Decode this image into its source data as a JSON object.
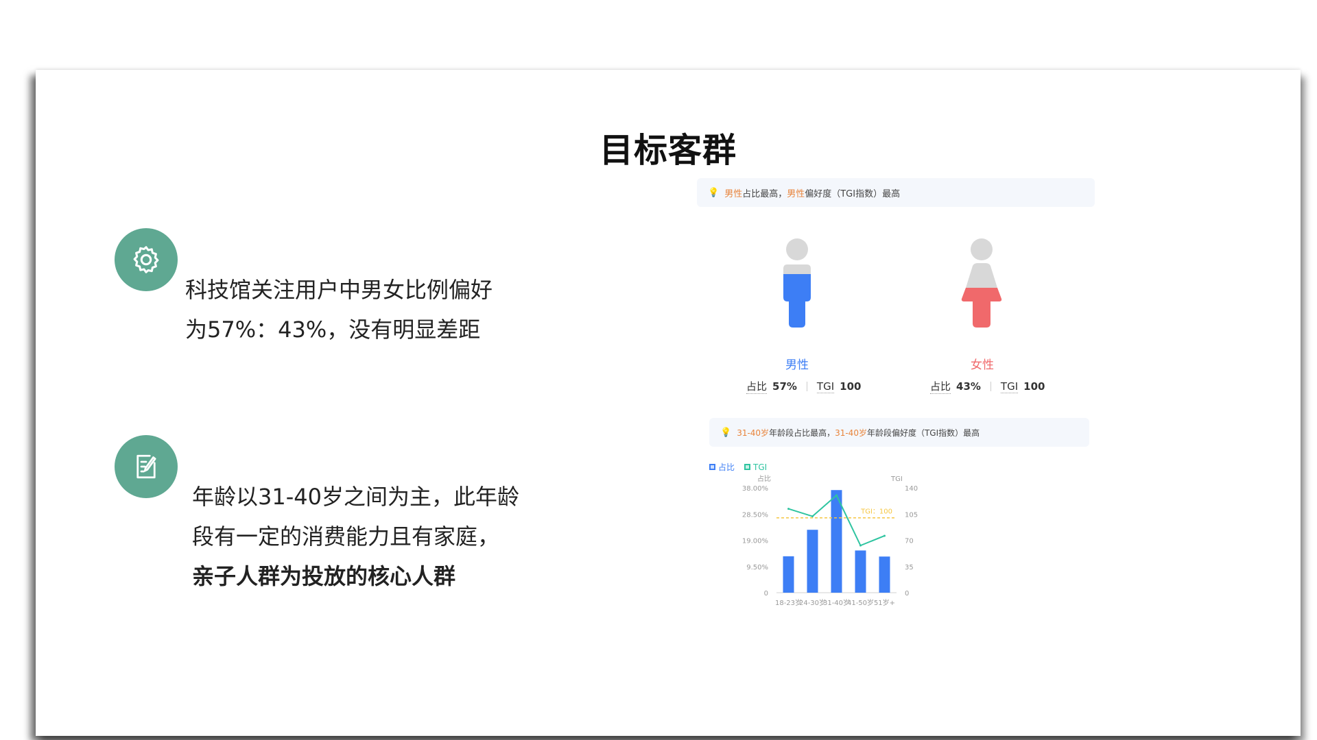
{
  "slide": {
    "title": "目标客群"
  },
  "left": {
    "point1": {
      "icon": "gear-icon",
      "line1": "科技馆关注用户中男女比例偏好",
      "line2": "为57%：43%，没有明显差距"
    },
    "point2": {
      "icon": "edit-document-icon",
      "line1": "年龄以31-40岁之间为主，此年龄",
      "line2": "段有一定的消费能力且有家庭，",
      "line3": "亲子人群为投放的核心人群"
    }
  },
  "gender": {
    "tip": {
      "hl1": "男性",
      "t1": "占比最高，",
      "hl2": "男性",
      "t2": "偏好度（TGI指数）最高"
    },
    "male": {
      "label": "男性",
      "share_key": "占比",
      "share_value": "57%",
      "tgi_key": "TGI",
      "tgi_value": "100",
      "color": "#3d7ef5"
    },
    "female": {
      "label": "女性",
      "share_key": "占比",
      "share_value": "43%",
      "tgi_key": "TGI",
      "tgi_value": "100",
      "color": "#f0696b"
    }
  },
  "age": {
    "tip": {
      "hl1": "31-40岁",
      "t1": "年龄段占比最高，",
      "hl2": "31-40岁",
      "t2": "年龄段偏好度（TGI指数）最高"
    },
    "legend": {
      "share": "占比",
      "tgi": "TGI"
    }
  },
  "chart_data": {
    "type": "bar",
    "categories": [
      "18-23岁",
      "24-30岁",
      "31-40岁",
      "41-50岁",
      "51岁+"
    ],
    "series": [
      {
        "name": "占比",
        "type": "bar",
        "axis": "left",
        "color": "#3d7ef5",
        "values": [
          13.2,
          22.8,
          37.2,
          15.3,
          13.1
        ]
      },
      {
        "name": "TGI",
        "type": "line",
        "axis": "right",
        "color": "#2ec4a0",
        "values": [
          112,
          102,
          130,
          63,
          76
        ]
      }
    ],
    "y_left": {
      "label": "占比",
      "ticks": [
        "0",
        "9.50%",
        "19.00%",
        "28.50%",
        "38.00%"
      ],
      "ylim": [
        0,
        38
      ]
    },
    "y_right": {
      "label": "TGI",
      "ticks": [
        "0",
        "35",
        "70",
        "105",
        "140"
      ],
      "ylim": [
        0,
        140
      ]
    },
    "reference_line": {
      "label": "TGI：100",
      "value": 100,
      "axis": "right",
      "color": "#f5c642"
    },
    "grid": false,
    "legend_position": "top-left"
  }
}
